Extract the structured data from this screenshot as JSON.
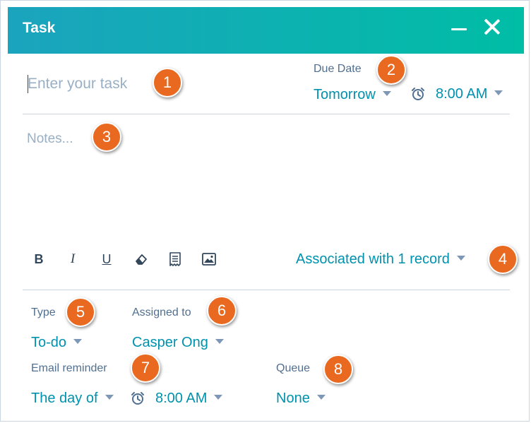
{
  "header": {
    "title": "Task"
  },
  "task": {
    "placeholder": "Enter your task"
  },
  "due_date": {
    "label": "Due Date",
    "date": "Tomorrow",
    "time": "8:00 AM"
  },
  "notes": {
    "placeholder": "Notes..."
  },
  "toolbar": {
    "bold": "B",
    "italic": "I",
    "underline": "U"
  },
  "association": {
    "label": "Associated with 1 record"
  },
  "type": {
    "label": "Type",
    "value": "To-do"
  },
  "assigned": {
    "label": "Assigned to",
    "value": "Casper Ong"
  },
  "reminder": {
    "label": "Email reminder",
    "value": "The day of",
    "time": "8:00 AM"
  },
  "queue": {
    "label": "Queue",
    "value": "None"
  },
  "callouts": [
    "1",
    "2",
    "3",
    "4",
    "5",
    "6",
    "7",
    "8"
  ],
  "colors": {
    "header_start": "#1ba4be",
    "header_end": "#00bda5",
    "link": "#0091ae",
    "callout": "#e8691f"
  },
  "icons": [
    "minimize-icon",
    "close-icon",
    "alarm-clock-icon",
    "eraser-icon",
    "snippet-icon",
    "image-icon",
    "caret-down-icon"
  ]
}
